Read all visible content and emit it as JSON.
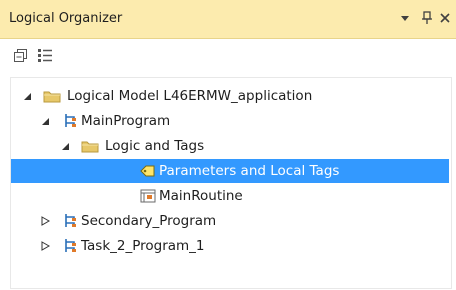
{
  "window": {
    "title": "Logical Organizer",
    "controls": {
      "dropdown": "▾",
      "pin": "ᵖ",
      "close": "×"
    }
  },
  "toolbar": {
    "buttons": [
      {
        "name": "collapse-all",
        "icon": "collapse-all-icon"
      },
      {
        "name": "properties",
        "icon": "properties-icon"
      }
    ]
  },
  "tree": {
    "items": [
      {
        "label": "Logical Model L46ERMW_application",
        "icon": "folder-icon",
        "expanded": true,
        "level": 0
      },
      {
        "label": "MainProgram",
        "icon": "program-icon",
        "expanded": true,
        "level": 1
      },
      {
        "label": "Logic and Tags",
        "icon": "folder-icon",
        "expanded": true,
        "level": 2
      },
      {
        "label": "Parameters and Local Tags",
        "icon": "tag-icon",
        "level": 3,
        "selected": true
      },
      {
        "label": "MainRoutine",
        "icon": "routine-icon",
        "level": 3
      },
      {
        "label": "Secondary_Program",
        "icon": "program-icon",
        "expanded": false,
        "level": 1
      },
      {
        "label": "Task_2_Program_1",
        "icon": "program-icon",
        "expanded": false,
        "level": 1
      }
    ]
  },
  "colors": {
    "titlebar_bg": "#fcebae",
    "selection_bg": "#3399ff",
    "folder": "#e7c86a"
  }
}
